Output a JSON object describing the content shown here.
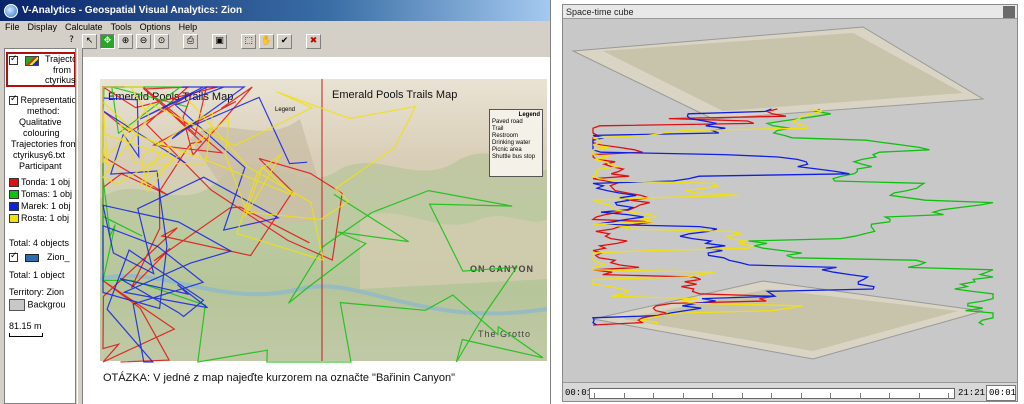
{
  "window": {
    "title": "V-Analytics - Geospatial Visual Analytics: Zion"
  },
  "menu": [
    "File",
    "Display",
    "Calculate",
    "Tools",
    "Options",
    "Help"
  ],
  "toolbar": {
    "help_label": "?",
    "buttons": [
      "select-icon",
      "zoom-in-icon",
      "zoom-out-icon",
      "print-icon",
      "save-icon",
      "select-rect-icon",
      "pan-hand-icon",
      "check-icon",
      "remove-icon"
    ]
  },
  "legend": {
    "layer1_name": "Trajectories from ctyrikusy",
    "layer1_name_lines": [
      "Trajecto",
      "from",
      "ctyrikus"
    ],
    "representation_lines": [
      "Representation",
      "method:",
      "Qualitative",
      "colouring",
      "Trajectories from",
      "ctyrikusy6.txt",
      "Participant"
    ],
    "participants": [
      {
        "name": "Tonda: 1 obj",
        "color": "#e01010"
      },
      {
        "name": "Tomas: 1 obj",
        "color": "#10c010"
      },
      {
        "name": "Marek: 1 obj",
        "color": "#1020e0"
      },
      {
        "name": "Rosta: 1 obj",
        "color": "#f0e010"
      }
    ],
    "total1": "Total: 4 objects",
    "layer2_name": "Zion_",
    "total2": "Total: 1 object",
    "territory": "Territory: Zion",
    "background": "Backgrou",
    "scale": "81.15 m"
  },
  "map": {
    "title_left": "Emerald Pools Trails Map",
    "title_right": "Emerald Pools Trails Map",
    "legend_title": "Legend",
    "legend_items": [
      "Paved road",
      "Trail",
      "Restroom",
      "Drinking water",
      "Picnic area",
      "Shuttle bus stop"
    ],
    "canyon_label": "ON   CANYON",
    "grotto_label": "The Grotto",
    "note": "OTÁZKA: V jedné z map najeďte kurzorem na označte \"Bařinin Canyon\""
  },
  "cube": {
    "title": "Space-time cube",
    "time_start": "00:01",
    "time_end": "21:21",
    "time_current": "00:01"
  }
}
